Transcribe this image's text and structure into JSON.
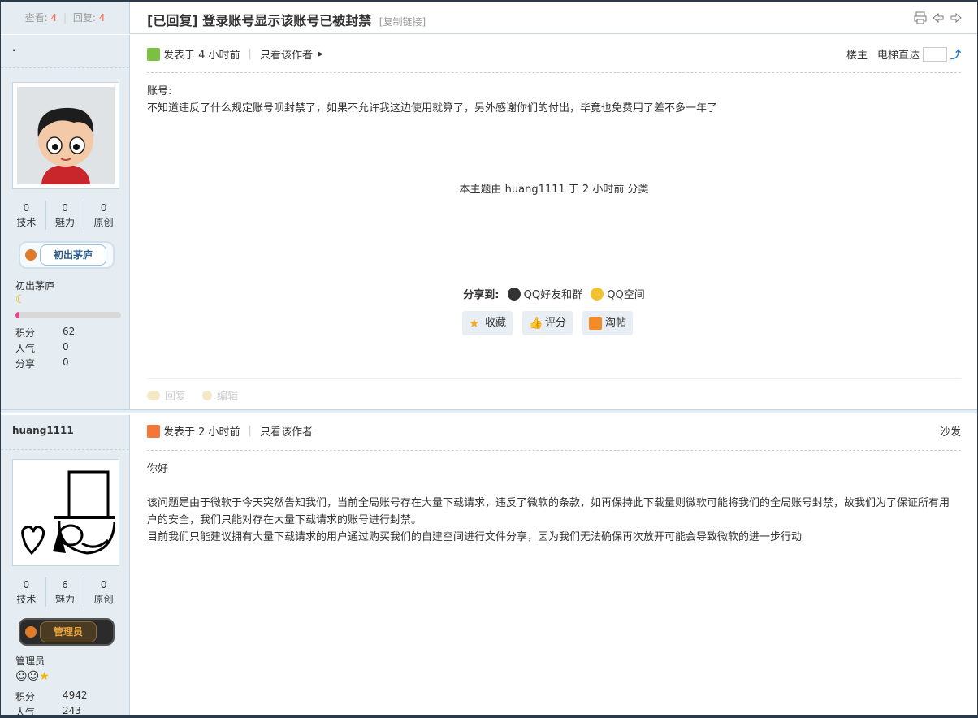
{
  "header": {
    "views_label": "查看:",
    "views": "4",
    "sep": "|",
    "replies_label": "回复:",
    "replies": "4",
    "title": "[已回复] 登录账号显示该账号已被封禁",
    "copy_link": "[复制链接]"
  },
  "post1": {
    "username": "·",
    "stats": [
      {
        "value": "0",
        "label": "技术"
      },
      {
        "value": "0",
        "label": "魅力"
      },
      {
        "value": "0",
        "label": "原创"
      }
    ],
    "badge": "初出茅庐",
    "group": "初出茅庐",
    "progress": 0.04,
    "credits": [
      {
        "k": "积分",
        "v": "62"
      },
      {
        "k": "人气",
        "v": "0"
      },
      {
        "k": "分享",
        "v": "0"
      }
    ],
    "posted": "发表于 4 小时前",
    "only_author": "只看该作者",
    "floor": "楼主",
    "elevator": "电梯直达",
    "body_line1": "账号:",
    "body_line2": "不知道违反了什么规定账号呗封禁了，如果不允许我这边使用就算了，另外感谢你们的付出，毕竟也免费用了差不多一年了",
    "moved_note": "本主题由 huang1111 于 2 小时前 分类",
    "share_label": "分享到:",
    "share_qq": "QQ好友和群",
    "share_qzone": "QQ空间",
    "btn_fav": "收藏",
    "btn_rate": "评分",
    "btn_tao": "淘帖",
    "reply": "回复",
    "edit": "编辑"
  },
  "post2": {
    "username": "huang1111",
    "stats": [
      {
        "value": "0",
        "label": "技术"
      },
      {
        "value": "6",
        "label": "魅力"
      },
      {
        "value": "0",
        "label": "原创"
      }
    ],
    "badge": "管理员",
    "group": "管理员",
    "credits": [
      {
        "k": "积分",
        "v": "4942"
      },
      {
        "k": "人气",
        "v": "243"
      }
    ],
    "posted": "发表于 2 小时前",
    "only_author": "只看该作者",
    "floor": "沙发",
    "greeting": "你好",
    "para1": "该问题是由于微软于今天突然告知我们，当前全局账号存在大量下载请求，违反了微软的条款，如再保持此下载量则微软可能将我们的全局账号封禁，故我们为了保证所有用户的安全，我们只能对存在大量下载请求的账号进行封禁。",
    "para2": "目前我们只能建议拥有大量下载请求的用户通过购买我们的自建空间进行文件分享，因为我们无法确保再次放开可能会导致微软的进一步行动"
  },
  "colors": {
    "accent": "#f26c4f",
    "side_bg": "#e5edf2",
    "border": "#c2d5e3"
  }
}
